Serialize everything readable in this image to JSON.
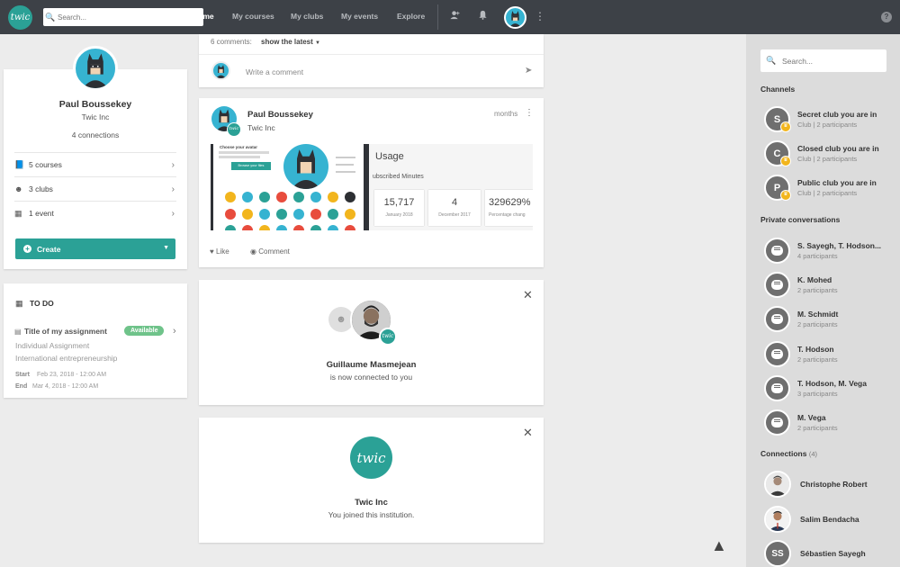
{
  "nav": {
    "logo_text": "twic",
    "search_placeholder": "Search...",
    "links": [
      {
        "label": "Home"
      },
      {
        "label": "My courses"
      },
      {
        "label": "My clubs"
      },
      {
        "label": "My events"
      },
      {
        "label": "Explore"
      }
    ],
    "help_label": "?"
  },
  "profile": {
    "name": "Paul Boussekey",
    "institution": "Twic Inc",
    "connections": "4 connections",
    "menu": [
      {
        "label": "5 courses",
        "icon": "book-icon"
      },
      {
        "label": "3 clubs",
        "icon": "people-icon"
      },
      {
        "label": "1 event",
        "icon": "calendar-icon"
      }
    ],
    "create_label": "Create"
  },
  "todo": {
    "title": "TO DO",
    "assignment_title": "Title of my assignment",
    "badge": "Available",
    "line1": "Individual Assignment",
    "line2": "International entrepreneurship",
    "start_label": "Start",
    "start_value": "Feb 23, 2018 - 12:00 AM",
    "end_label": "End",
    "end_value": "Mar 4, 2018 - 12:00 AM"
  },
  "feed": {
    "comments_count": "6 comments:",
    "show_latest": "show the latest",
    "comment_placeholder": "Write a comment",
    "post": {
      "author": "Paul Boussekey",
      "institution": "Twic Inc",
      "time": "months",
      "like_label": "Like",
      "comment_label": "Comment",
      "preview_left": {
        "heading": "Choose your avatar",
        "button": "Browse your files"
      },
      "preview_right": {
        "title": "Usage",
        "subtitle": "ubscribed Minutes",
        "stats": [
          {
            "value": "15,717",
            "label": "January 2018"
          },
          {
            "value": "4",
            "label": "December 2017"
          },
          {
            "value": "329629%",
            "label": "Percentage chang"
          }
        ]
      }
    },
    "connection_card": {
      "name": "Guillaume Masmejean",
      "text": "is now connected to you"
    },
    "institution_card": {
      "name": "Twic Inc",
      "text": "You joined this institution.",
      "logo_text": "twic"
    }
  },
  "sidebar": {
    "search_placeholder": "Search...",
    "channels_heading": "Channels",
    "channels": [
      {
        "initial": "S",
        "name": "Secret club you are in",
        "meta": "Club | 2 participants"
      },
      {
        "initial": "C",
        "name": "Closed club you are in",
        "meta": "Club | 2 participants"
      },
      {
        "initial": "P",
        "name": "Public club you are in",
        "meta": "Club | 2 participants"
      }
    ],
    "private_heading": "Private conversations",
    "conversations": [
      {
        "name": "S. Sayegh, T. Hodson...",
        "meta": "4 participants"
      },
      {
        "name": "K. Mohed",
        "meta": "2 participants"
      },
      {
        "name": "M. Schmidt",
        "meta": "2 participants"
      },
      {
        "name": "T. Hodson",
        "meta": "2 participants"
      },
      {
        "name": "T. Hodson, M. Vega",
        "meta": "3 participants"
      },
      {
        "name": "M. Vega",
        "meta": "2 participants"
      }
    ],
    "connections_heading": "Connections",
    "connections_count": "(4)",
    "connections": [
      {
        "name": "Christophe Robert"
      },
      {
        "name": "Salim Bendacha"
      },
      {
        "name": "Sébastien Sayegh",
        "initials": "SS"
      }
    ]
  },
  "colors": {
    "brand": "#2ba196",
    "nav_bg": "#3d4147",
    "avatar_blue": "#36b3d1",
    "badge_green": "#6fc38a",
    "club_badge": "#f2b51d"
  }
}
